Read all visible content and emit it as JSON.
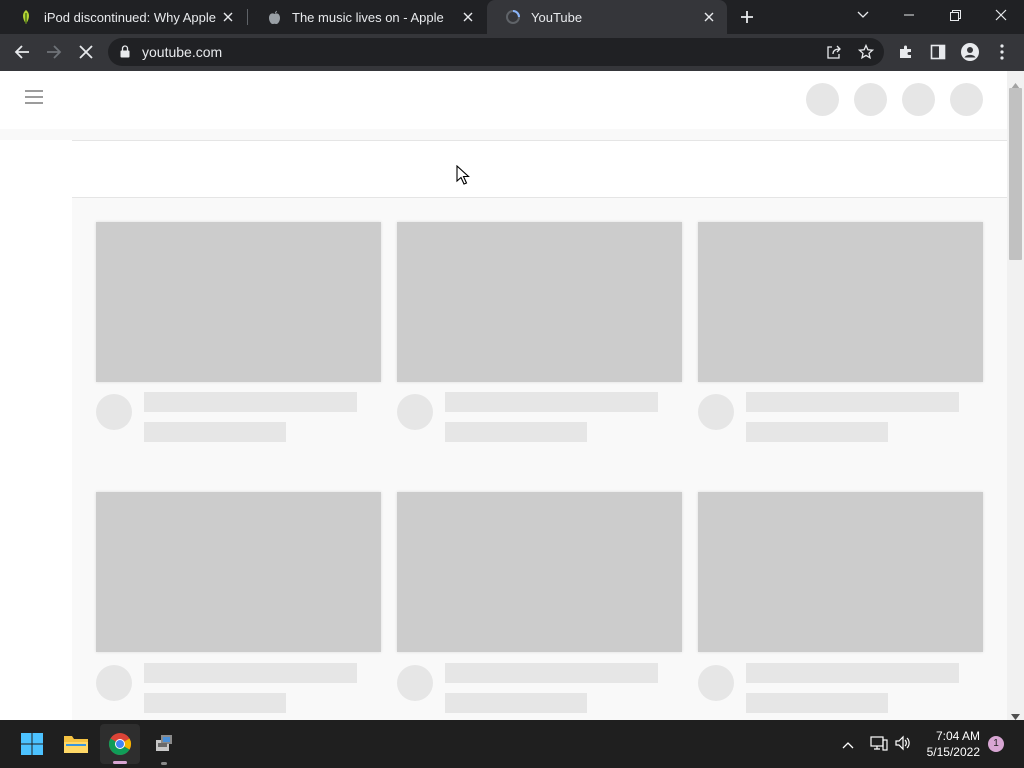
{
  "browser": {
    "tabs": [
      {
        "title": "iPod discontinued: Why Apple is",
        "favicon": "green-leaf-icon",
        "active": false
      },
      {
        "title": "The music lives on - Apple",
        "favicon": "apple-logo-icon",
        "active": false
      },
      {
        "title": "YouTube",
        "favicon": "loading-spinner-icon",
        "active": true
      }
    ],
    "url": "youtube.com"
  },
  "taskbar": {
    "time": "7:04 AM",
    "date": "5/15/2022",
    "notification_count": "1"
  },
  "colors": {
    "chrome_dark": "#202124",
    "toolbar": "#35363a",
    "page_bg": "#f9f9f9",
    "skeleton_thumb": "#cccccc",
    "skeleton_line": "#e6e6e6",
    "taskbar": "#1f1f1f"
  }
}
